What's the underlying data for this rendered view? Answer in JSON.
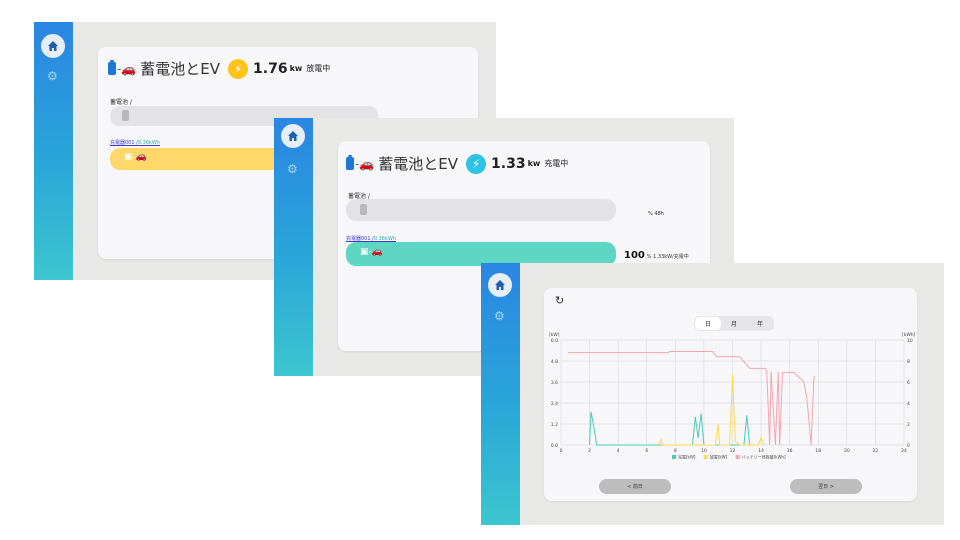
{
  "screen1": {
    "title": "蓄電池とEV",
    "power": "1.76",
    "unit": "kw",
    "status": "放電中",
    "battery_label": "蓄電池 /",
    "charger_label": "充電器001 /",
    "charger_sub": "0.36kWh",
    "battery_level": 0,
    "charger_level": 100
  },
  "screen2": {
    "title": "蓄電池とEV",
    "power": "1.33",
    "unit": "kw",
    "status": "充電中",
    "battery_label": "蓄電池 /",
    "battery_pct": "% 48h",
    "charger_label": "充電器001 /",
    "charger_sub": "0.36kWh",
    "charger_pct": "100",
    "charger_pct_sub": "% 1.33kW/充電中",
    "battery_level": 0,
    "charger_level": 100
  },
  "screen3": {
    "refresh_icon": "refresh-icon",
    "tabs": [
      {
        "label": "日",
        "selected": true
      },
      {
        "label": "月",
        "selected": false
      },
      {
        "label": "年",
        "selected": false
      }
    ],
    "prev_button": "< 前日",
    "next_button": "翌日 >",
    "chart_data": {
      "type": "line",
      "x": [
        0,
        1,
        2,
        3,
        4,
        5,
        6,
        7,
        8,
        9,
        10,
        11,
        12,
        13,
        14,
        15,
        16,
        17,
        18,
        19,
        20,
        21,
        22,
        23,
        24
      ],
      "xlim": [
        0,
        24
      ],
      "xticks": [
        "0",
        "2",
        "4",
        "6",
        "8",
        "10",
        "12",
        "14",
        "16",
        "18",
        "20",
        "22",
        "24"
      ],
      "ylim_left": [
        0,
        6
      ],
      "yticks_left": [
        "0.0",
        "1.2",
        "2.4",
        "3.6",
        "4.8",
        "6.0"
      ],
      "ylabel_left": "[kW]",
      "ylim_right": [
        0,
        10
      ],
      "yticks_right": [
        "0",
        "2",
        "4",
        "6",
        "8",
        "10"
      ],
      "ylabel_right": "[kWh]",
      "grid": true,
      "legend_position": "bottom",
      "series": [
        {
          "name": "充電[kW]",
          "color": "#4dc9b8",
          "points": [
            [
              2,
              0
            ],
            [
              2.1,
              1.9
            ],
            [
              2.3,
              1.0
            ],
            [
              2.5,
              0
            ],
            [
              9.2,
              0
            ],
            [
              9.4,
              1.6
            ],
            [
              9.6,
              0.4
            ],
            [
              9.8,
              1.8
            ],
            [
              10,
              0
            ],
            [
              12.8,
              0
            ],
            [
              13,
              1.7
            ],
            [
              13.2,
              0
            ]
          ]
        },
        {
          "name": "放電[kW]",
          "color": "#ffd84d",
          "points": [
            [
              6.8,
              0
            ],
            [
              7.0,
              0.3
            ],
            [
              7.1,
              0
            ],
            [
              10.8,
              0
            ],
            [
              11.0,
              1.2
            ],
            [
              11.1,
              0
            ],
            [
              11.8,
              0
            ],
            [
              12.0,
              4.0
            ],
            [
              12.2,
              0.2
            ],
            [
              12.5,
              0
            ],
            [
              13.8,
              0
            ],
            [
              14.0,
              0.4
            ],
            [
              14.2,
              0
            ]
          ]
        },
        {
          "name": "バッテリー残容量[kWh]",
          "color": "#f3a6ad",
          "points": [
            [
              0.5,
              8.8
            ],
            [
              7.5,
              8.8
            ],
            [
              7.6,
              8.9
            ],
            [
              10.6,
              8.9
            ],
            [
              10.9,
              8.4
            ],
            [
              12.5,
              8.4
            ],
            [
              13.2,
              7.3
            ],
            [
              14.3,
              7.3
            ],
            [
              14.4,
              7.0
            ],
            [
              14.6,
              0
            ],
            [
              14.7,
              7.0
            ],
            [
              15.0,
              0
            ],
            [
              15.2,
              7.0
            ],
            [
              15.3,
              0
            ],
            [
              15.5,
              6.9
            ],
            [
              16.3,
              6.9
            ],
            [
              17,
              6.0
            ],
            [
              17.2,
              4.5
            ],
            [
              17.5,
              0
            ],
            [
              17.7,
              6.5
            ],
            [
              17.8,
              6.5
            ]
          ]
        }
      ]
    }
  }
}
